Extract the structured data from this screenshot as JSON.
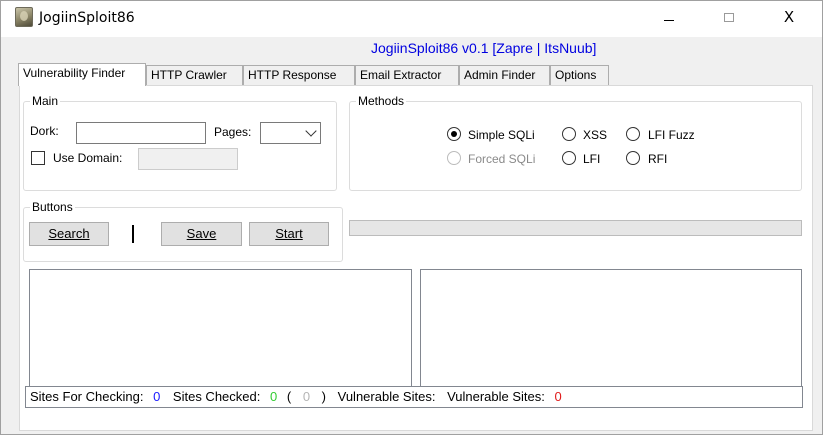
{
  "window": {
    "title": "JogiinSploit86"
  },
  "titlebar": {
    "minimize_glyph": "",
    "maximize_glyph": "",
    "close_glyph": "X"
  },
  "header": {
    "label": "JogiinSploit86 v0.1 [Zapre | ItsNuub]"
  },
  "tabs": [
    {
      "label": "Vulnerability Finder"
    },
    {
      "label": "HTTP Crawler"
    },
    {
      "label": "HTTP Response"
    },
    {
      "label": "Email Extractor"
    },
    {
      "label": "Admin Finder"
    },
    {
      "label": "Options"
    }
  ],
  "main_group": {
    "title": "Main",
    "dork_label": "Dork:",
    "dork_value": "",
    "pages_label": "Pages:",
    "pages_value": "",
    "use_domain_label": "Use Domain:",
    "use_domain_checked": false,
    "domain_value": ""
  },
  "methods_group": {
    "title": "Methods",
    "simple_sqli": "Simple SQLi",
    "xss": "XSS",
    "lfi_fuzz": "LFI Fuzz",
    "forced_sqli": "Forced SQLi",
    "lfi": "LFI",
    "rfi": "RFI",
    "selected": "Simple SQLi"
  },
  "buttons_group": {
    "title": "Buttons",
    "search_label": "Search",
    "save_label": "Save",
    "start_label": "Start"
  },
  "progress": {
    "value": 0
  },
  "status": {
    "sites_for_checking_label": "Sites For Checking:",
    "sites_for_checking_value": "0",
    "sites_checked_label": "Sites Checked:",
    "sites_checked_value": "0",
    "open_paren": "(",
    "sites_checked_extra": "0",
    "close_paren": ")",
    "vulnerable_label_1": "Vulnerable Sites:",
    "vulnerable_label_2": "Vulnerable Sites:",
    "vulnerable_value": "0"
  }
}
